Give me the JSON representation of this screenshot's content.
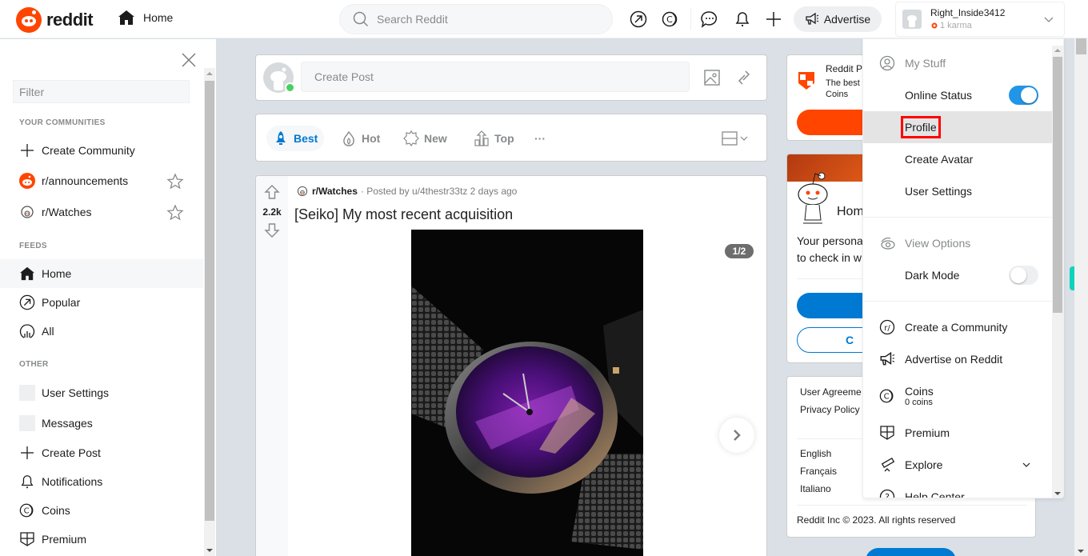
{
  "header": {
    "logo_text": "reddit",
    "home_label": "Home",
    "search_placeholder": "Search Reddit",
    "advertise_label": "Advertise",
    "user": {
      "name": "Right_Inside3412",
      "karma": "1 karma"
    },
    "icons": [
      "popular-icon",
      "coins-icon",
      "chat-icon",
      "notifications-icon",
      "create-post-icon"
    ]
  },
  "sidebar": {
    "filter_placeholder": "Filter",
    "sections": {
      "communities": "YOUR COMMUNITIES",
      "feeds": "FEEDS",
      "other": "OTHER"
    },
    "communities": [
      {
        "label": "Create Community",
        "icon": "plus-icon"
      },
      {
        "label": "r/announcements",
        "icon": "reddit-icon",
        "favorite": false
      },
      {
        "label": "r/Watches",
        "icon": "watches-icon",
        "favorite": false
      }
    ],
    "feeds": [
      {
        "label": "Home",
        "icon": "home-icon",
        "active": true
      },
      {
        "label": "Popular",
        "icon": "popular-icon"
      },
      {
        "label": "All",
        "icon": "all-icon"
      }
    ],
    "other": [
      {
        "label": "User Settings",
        "icon": "avatar-icon"
      },
      {
        "label": "Messages",
        "icon": "avatar-icon"
      },
      {
        "label": "Create Post",
        "icon": "plus-icon"
      },
      {
        "label": "Notifications",
        "icon": "bell-icon"
      },
      {
        "label": "Coins",
        "icon": "coins-icon"
      },
      {
        "label": "Premium",
        "icon": "premium-icon"
      }
    ]
  },
  "create_post": {
    "placeholder": "Create Post"
  },
  "sort": {
    "options": [
      {
        "label": "Best",
        "active": true
      },
      {
        "label": "Hot",
        "active": false
      },
      {
        "label": "New",
        "active": false
      },
      {
        "label": "Top",
        "active": false
      }
    ],
    "more": "···"
  },
  "post": {
    "votes": "2.2k",
    "subreddit": "r/Watches",
    "byline": "· Posted by u/4thestr33tz 2 days ago",
    "title": "[Seiko] My most recent acquisition",
    "image_counter": "1/2",
    "image_index": 1,
    "image_total": 2
  },
  "right": {
    "premium": {
      "title": "Reddit P",
      "desc": "The best",
      "desc2": "Coins"
    },
    "home": {
      "title": "Hom",
      "desc1": "Your persona",
      "desc2": "to check in w",
      "btn2": "C"
    },
    "footer": {
      "links": [
        "User Agreeme",
        "Privacy Policy"
      ],
      "languages": [
        "English",
        "Français",
        "Italiano"
      ],
      "copyright": "Reddit Inc © 2023. All rights reserved"
    }
  },
  "dropdown": {
    "my_stuff": "My Stuff",
    "online_status": {
      "label": "Online Status",
      "on": true
    },
    "profile": "Profile",
    "create_avatar": "Create Avatar",
    "user_settings": "User Settings",
    "view_options": "View Options",
    "dark_mode": {
      "label": "Dark Mode",
      "on": false
    },
    "create_community": "Create a Community",
    "advertise": "Advertise on Reddit",
    "coins": {
      "label": "Coins",
      "sub": "0 coins"
    },
    "premium": "Premium",
    "explore": "Explore",
    "help": "Help Center"
  },
  "colors": {
    "brand": "#ff4500",
    "accent": "#0079d3",
    "highlight_box": "#ff0000",
    "online": "#46d160"
  }
}
